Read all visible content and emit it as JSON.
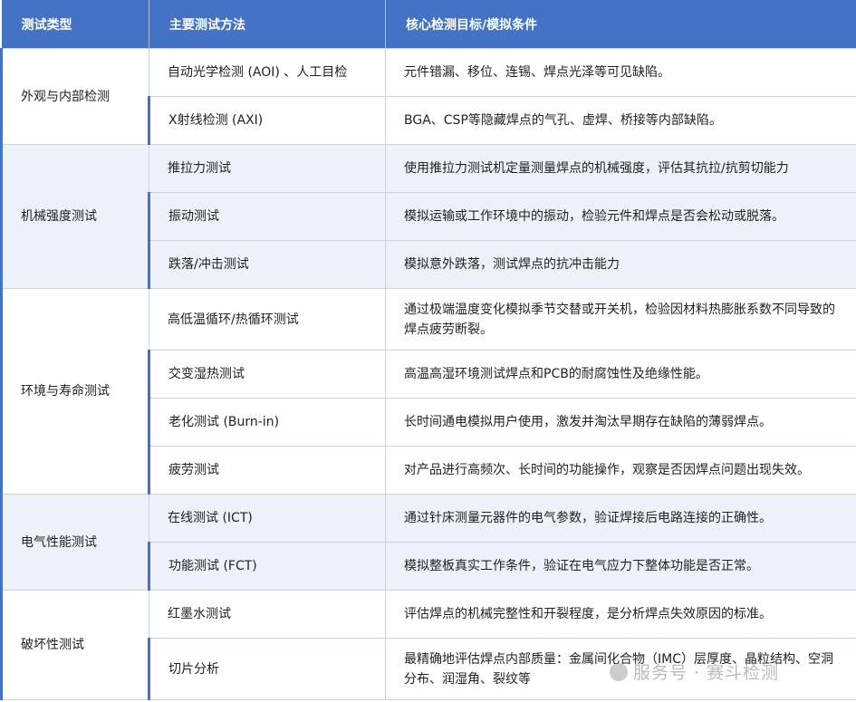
{
  "headers": [
    "测试类型",
    "主要测试方法",
    "核心检测目标/模拟条件"
  ],
  "groups": [
    {
      "category": "外观与内部检测",
      "rows": [
        {
          "method": "自动光学检测 (AOI) 、人工目检",
          "goal": "元件错漏、移位、连锡、焊点光泽等可见缺陷。"
        },
        {
          "method": "X射线检测 (AXI)",
          "goal": "BGA、CSP等隐藏焊点的气孔、虚焊、桥接等内部缺陷。"
        }
      ]
    },
    {
      "category": "机械强度测试",
      "rows": [
        {
          "method": "推拉力测试",
          "goal": "使用推拉力测试机定量测量焊点的机械强度，评估其抗拉/抗剪切能力"
        },
        {
          "method": "振动测试",
          "goal": "模拟运输或工作环境中的振动，检验元件和焊点是否会松动或脱落。"
        },
        {
          "method": "跌落/冲击测试",
          "goal": "模拟意外跌落，测试焊点的抗冲击能力"
        }
      ]
    },
    {
      "category": "环境与寿命测试",
      "rows": [
        {
          "method": "高低温循环/热循环测试",
          "goal": "通过极端温度变化模拟季节交替或开关机，检验因材料热膨胀系数不同导致的焊点疲劳断裂。"
        },
        {
          "method": "交变湿热测试",
          "goal": "高温高湿环境测试焊点和PCB的耐腐蚀性及绝缘性能。"
        },
        {
          "method": "老化测试 (Burn-in)",
          "goal": "长时间通电模拟用户使用，激发并淘汰早期存在缺陷的薄弱焊点。"
        },
        {
          "method": "疲劳测试",
          "goal": "对产品进行高频次、长时间的功能操作，观察是否因焊点问题出现失效。"
        }
      ]
    },
    {
      "category": "电气性能测试",
      "rows": [
        {
          "method": "在线测试 (ICT)",
          "goal": "通过针床测量元器件的电气参数，验证焊接后电路连接的正确性。"
        },
        {
          "method": "功能测试 (FCT)",
          "goal": "模拟整板真实工作条件，验证在电气应力下整体功能是否正常。"
        }
      ]
    },
    {
      "category": "破坏性测试",
      "rows": [
        {
          "method": "红墨水测试",
          "goal": "评估焊点的机械完整性和开裂程度，是分析焊点失效原因的标准。"
        },
        {
          "method": "切片分析",
          "goal": "最精确地评估焊点内部质量：金属间化合物（IMC）层厚度、晶粒结构、空洞分布、润湿角、裂纹等"
        }
      ]
    }
  ],
  "watermark": "服务号 · 赛斗检测"
}
